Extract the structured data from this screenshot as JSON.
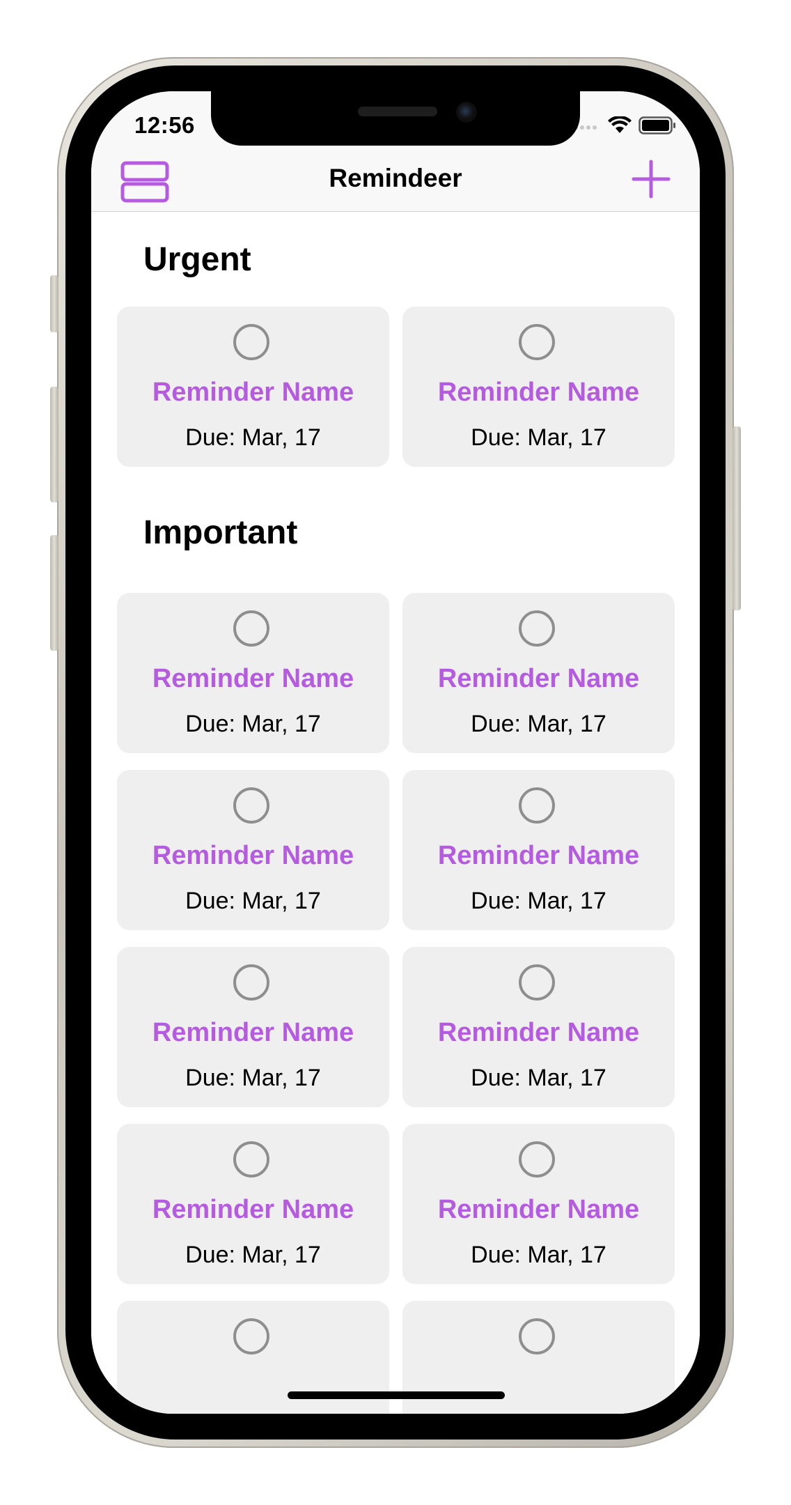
{
  "status": {
    "time": "12:56"
  },
  "nav": {
    "title": "Reminder",
    "title_full": "Remindeer",
    "accent_color": "#b55be0",
    "left_icon": "layout-rows-icon",
    "right_icon": "plus-icon"
  },
  "sections": [
    {
      "title": "Urgent",
      "cards": [
        {
          "name": "Reminder Name",
          "due": "Due: Mar, 17"
        },
        {
          "name": "Reminder Name",
          "due": "Due: Mar, 17"
        }
      ]
    },
    {
      "title": "Important",
      "cards": [
        {
          "name": "Reminder Name",
          "due": "Due: Mar, 17"
        },
        {
          "name": "Reminder Name",
          "due": "Due: Mar, 17"
        },
        {
          "name": "Reminder Name",
          "due": "Due: Mar, 17"
        },
        {
          "name": "Reminder Name",
          "due": "Due: Mar, 17"
        },
        {
          "name": "Reminder Name",
          "due": "Due: Mar, 17"
        },
        {
          "name": "Reminder Name",
          "due": "Due: Mar, 17"
        },
        {
          "name": "Reminder Name",
          "due": "Due: Mar, 17"
        },
        {
          "name": "Reminder Name",
          "due": "Due: Mar, 17"
        },
        {
          "name": "",
          "due": ""
        },
        {
          "name": "",
          "due": ""
        }
      ]
    }
  ]
}
